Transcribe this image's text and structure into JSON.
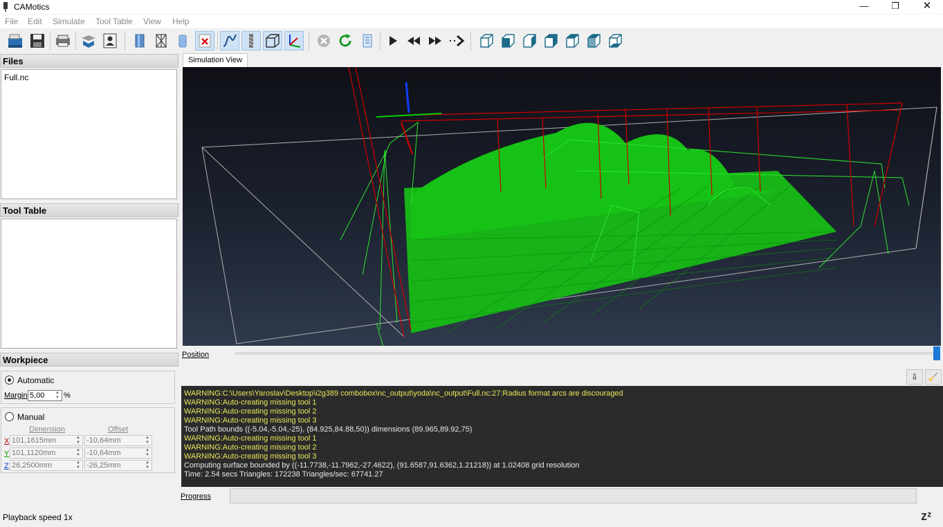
{
  "window": {
    "title": "CAMotics",
    "controls": {
      "minimize": "—",
      "maximize": "❐",
      "close": "✕"
    }
  },
  "menu": [
    "File",
    "Edit",
    "Simulate",
    "Tool Table",
    "View",
    "Help"
  ],
  "toolbar": {
    "buttons": [
      {
        "name": "open-folder-icon"
      },
      {
        "name": "save-icon"
      },
      {
        "name": "export-icon"
      },
      {
        "name": "settings-icon"
      },
      {
        "name": "user-icon"
      },
      {
        "name": "workpiece-icon"
      },
      {
        "name": "wireframe-icon"
      },
      {
        "name": "tool-icon"
      },
      {
        "name": "clear-icon"
      },
      {
        "name": "toolpath-icon",
        "active": true
      },
      {
        "name": "tool-view-icon",
        "active": true
      },
      {
        "name": "bounds-icon",
        "active": true
      },
      {
        "name": "axes-icon",
        "active": true
      },
      {
        "name": "stop-icon"
      },
      {
        "name": "rerun-icon"
      },
      {
        "name": "render-icon"
      },
      {
        "name": "play-icon"
      },
      {
        "name": "rewind-icon"
      },
      {
        "name": "fast-forward-icon"
      },
      {
        "name": "step-icon"
      },
      {
        "name": "view-iso-icon"
      },
      {
        "name": "view-front-icon"
      },
      {
        "name": "view-back-icon"
      },
      {
        "name": "view-left-icon"
      },
      {
        "name": "view-right-icon"
      },
      {
        "name": "view-top-icon"
      },
      {
        "name": "view-bottom-icon"
      }
    ]
  },
  "files": {
    "header": "Files",
    "items": [
      "Full.nc"
    ]
  },
  "tool_table": {
    "header": "Tool Table"
  },
  "workpiece": {
    "header": "Workpiece",
    "automatic": {
      "label": "Automatic",
      "checked": true,
      "margin_label": "Margin",
      "margin_value": "5,00",
      "margin_unit": "%"
    },
    "manual": {
      "label": "Manual",
      "checked": false,
      "col_dimension": "Dimension",
      "col_offset": "Offset",
      "rows": [
        {
          "axis": "X",
          "color": "#c00000",
          "dimension": "101,1615mm",
          "offset": "-10,64mm"
        },
        {
          "axis": "Y",
          "color": "#00a000",
          "dimension": "101,1120mm",
          "offset": "-10,64mm"
        },
        {
          "axis": "Z",
          "color": "#1040d0",
          "dimension": "26,2500mm",
          "offset": "-26,25mm"
        }
      ]
    }
  },
  "simulation": {
    "tab_label": "Simulation View",
    "position_label": "Position"
  },
  "console": {
    "lines": [
      {
        "type": "warn",
        "text": "WARNING:C:\\Users\\Yaroslav\\Desktop\\i2g389 combobox\\nc_output\\yoda\\nc_output\\Full.nc:27:Radius format arcs are discouraged"
      },
      {
        "type": "warn",
        "text": "WARNING:Auto-creating missing tool 1"
      },
      {
        "type": "warn",
        "text": "WARNING:Auto-creating missing tool 2"
      },
      {
        "type": "warn",
        "text": "WARNING:Auto-creating missing tool 3"
      },
      {
        "type": "info",
        "text": "Tool Path bounds ((-5.04,-5.04,-25), (84.925,84.88,50)) dimensions (89.965,89.92,75)"
      },
      {
        "type": "warn",
        "text": "WARNING:Auto-creating missing tool 1"
      },
      {
        "type": "warn",
        "text": "WARNING:Auto-creating missing tool 2"
      },
      {
        "type": "warn",
        "text": "WARNING:Auto-creating missing tool 3"
      },
      {
        "type": "info",
        "text": "Computing surface bounded by ((-11.7738,-11.7962,-27.4622), (91.6587,91.6362,1.21218)) at 1.02408 grid resolution"
      },
      {
        "type": "info",
        "text": "Time: 2.54 secs Triangles: 172238 Triangles/sec: 67741.27"
      }
    ]
  },
  "progress_label": "Progress",
  "status": {
    "playback": "Playback speed 1x",
    "idle_icon": "zᶻ"
  },
  "colors": {
    "accent": "#1e78d7",
    "toolpath": "#00c000",
    "rapid": "#d00000",
    "bounds": "#b0b0b0",
    "warning_text": "#e8e85a"
  }
}
